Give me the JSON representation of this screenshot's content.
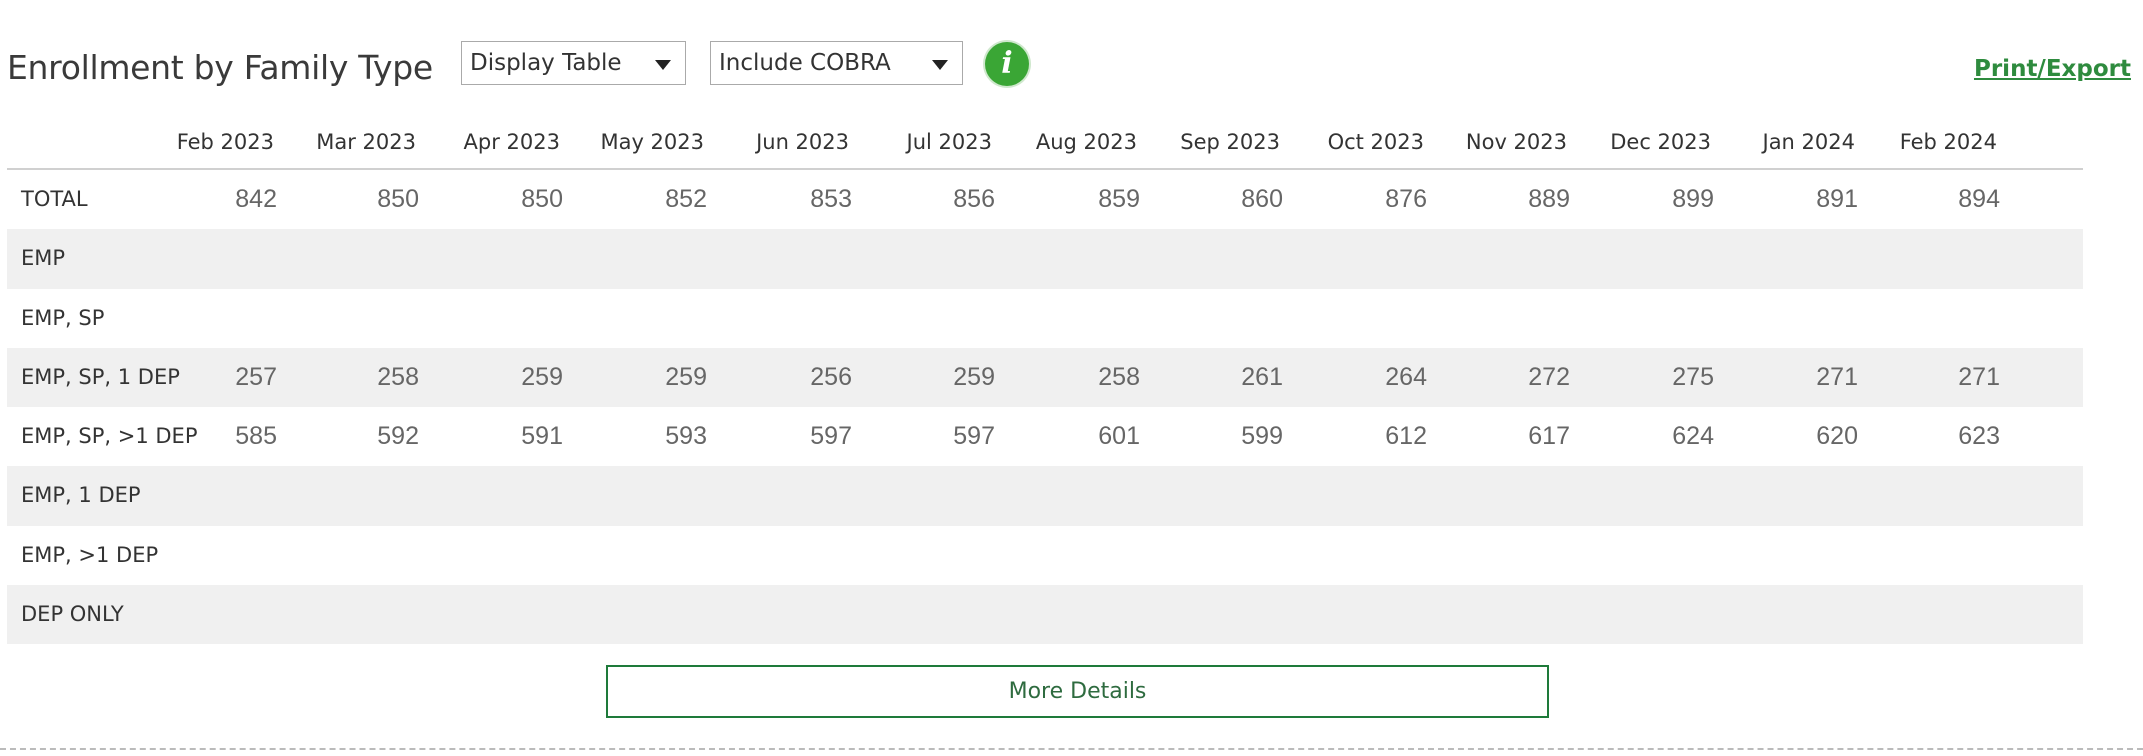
{
  "header": {
    "title": "Enrollment by Family Type",
    "display_select": "Display Table",
    "cobra_select": "Include COBRA",
    "info_glyph": "i",
    "print_link": "Print/Export"
  },
  "table": {
    "columns": [
      "Feb 2023",
      "Mar 2023",
      "Apr 2023",
      "May 2023",
      "Jun 2023",
      "Jul 2023",
      "Aug 2023",
      "Sep 2023",
      "Oct 2023",
      "Nov 2023",
      "Dec 2023",
      "Jan 2024",
      "Feb 2024"
    ],
    "rows": [
      {
        "label": "TOTAL",
        "values": [
          "842",
          "850",
          "850",
          "852",
          "853",
          "856",
          "859",
          "860",
          "876",
          "889",
          "899",
          "891",
          "894"
        ]
      },
      {
        "label": "EMP",
        "values": []
      },
      {
        "label": "EMP,  SP",
        "values": []
      },
      {
        "label": "EMP, SP,  1 DEP",
        "values": [
          "257",
          "258",
          "259",
          "259",
          "256",
          "259",
          "258",
          "261",
          "264",
          "272",
          "275",
          "271",
          "271"
        ]
      },
      {
        "label": "EMP, SP, >1 DEP",
        "values": [
          "585",
          "592",
          "591",
          "593",
          "597",
          "597",
          "601",
          "599",
          "612",
          "617",
          "624",
          "620",
          "623"
        ]
      },
      {
        "label": "EMP, 1 DEP",
        "values": []
      },
      {
        "label": "EMP, >1 DEP",
        "values": []
      },
      {
        "label": "DEP ONLY",
        "values": []
      }
    ]
  },
  "footer": {
    "more_details": "More Details"
  },
  "colors": {
    "accent_green": "#2e8b3e",
    "info_green": "#3aa635",
    "row_alt": "#f0f0f0"
  }
}
